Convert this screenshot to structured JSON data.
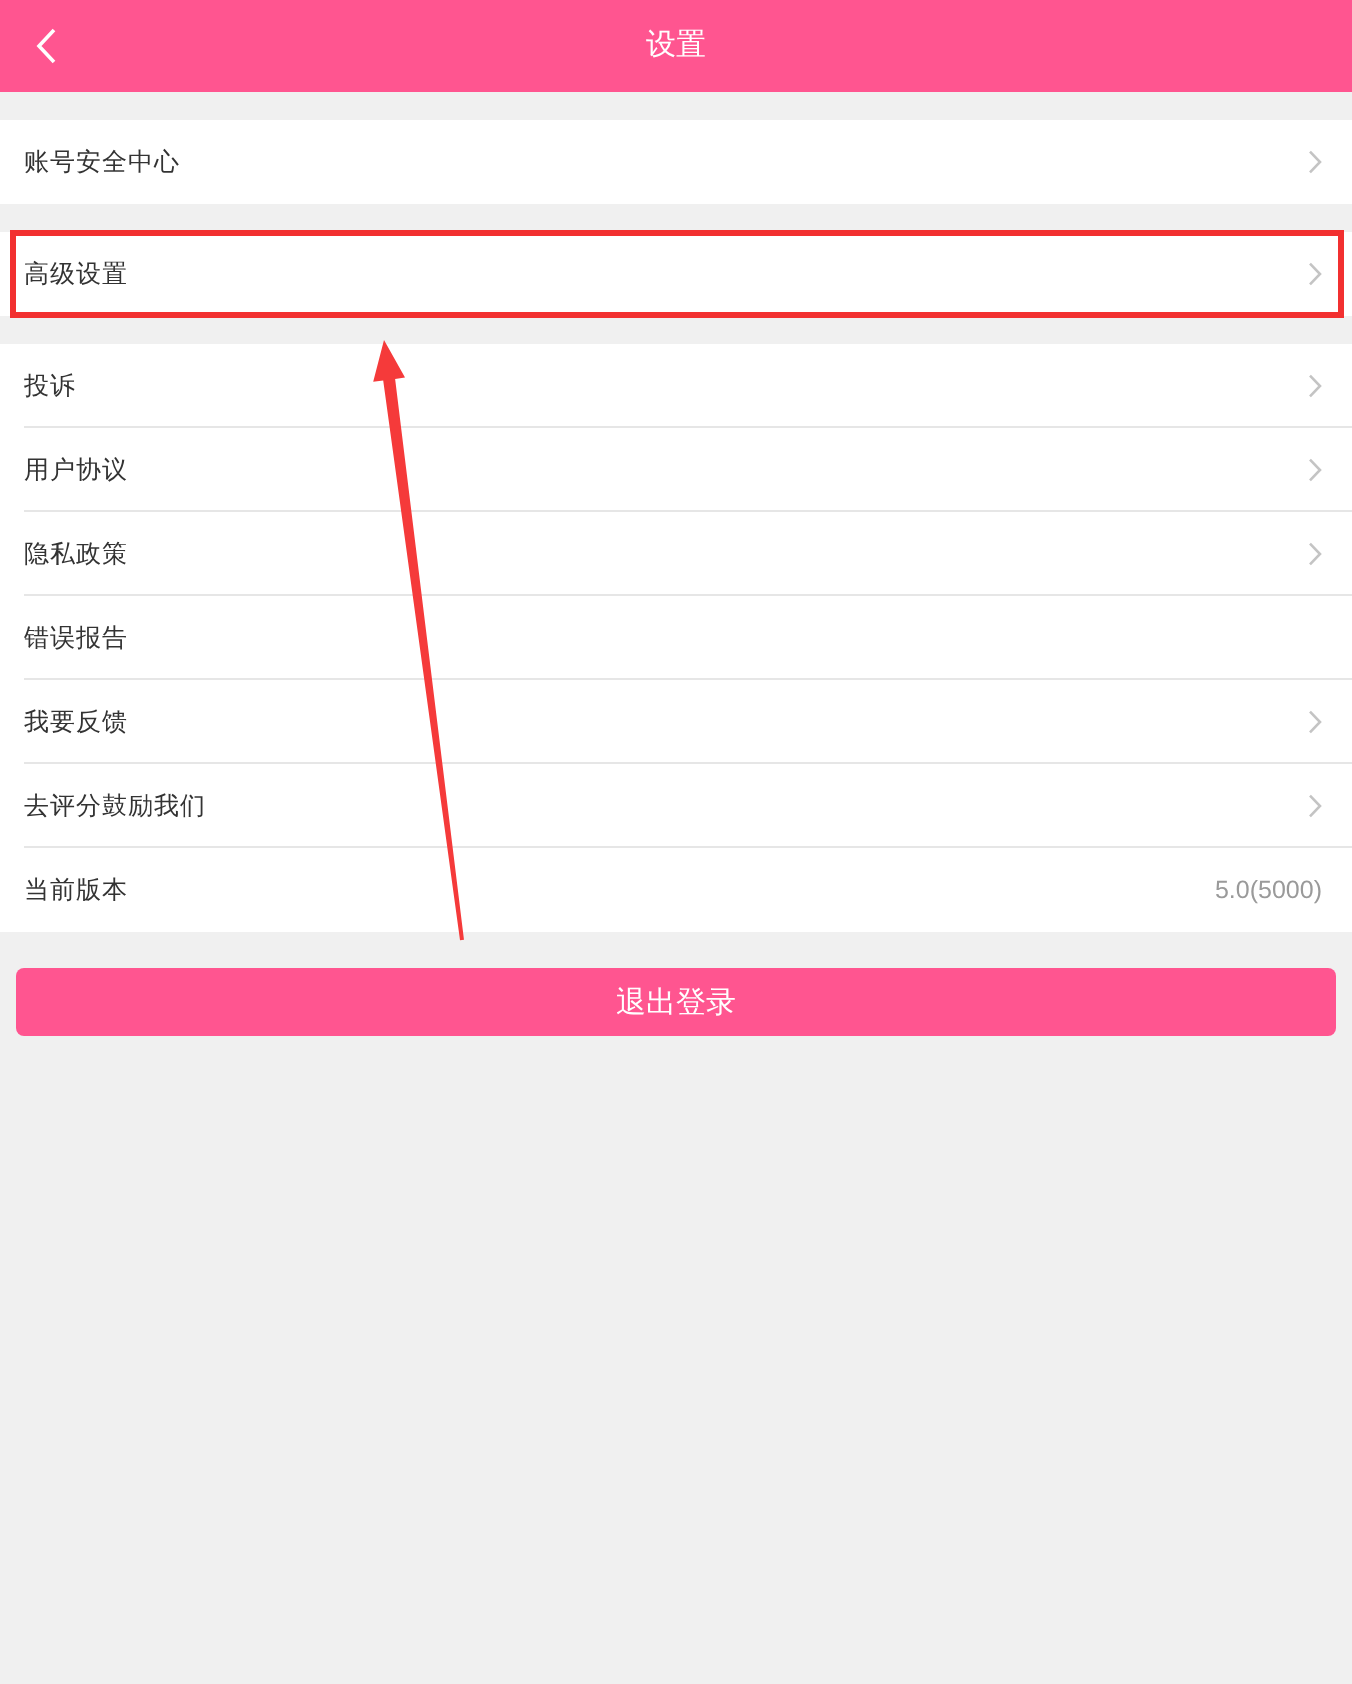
{
  "header": {
    "title": "设置"
  },
  "groups": [
    {
      "rows": [
        {
          "kind": "nav",
          "label": "账号安全中心",
          "highlighted": false
        }
      ]
    },
    {
      "rows": [
        {
          "kind": "nav",
          "label": "高级设置",
          "highlighted": true
        }
      ]
    },
    {
      "rows": [
        {
          "kind": "nav",
          "label": "投诉",
          "highlighted": false
        },
        {
          "kind": "nav",
          "label": "用户协议",
          "highlighted": false
        },
        {
          "kind": "nav",
          "label": "隐私政策",
          "highlighted": false
        },
        {
          "kind": "plain",
          "label": "错误报告",
          "highlighted": false
        },
        {
          "kind": "nav",
          "label": "我要反馈",
          "highlighted": false
        },
        {
          "kind": "nav",
          "label": "去评分鼓励我们",
          "highlighted": false
        },
        {
          "kind": "info",
          "label": "当前版本",
          "value": "5.0(5000)",
          "highlighted": false
        }
      ]
    }
  ],
  "logout_button": {
    "label": "退出登录"
  }
}
